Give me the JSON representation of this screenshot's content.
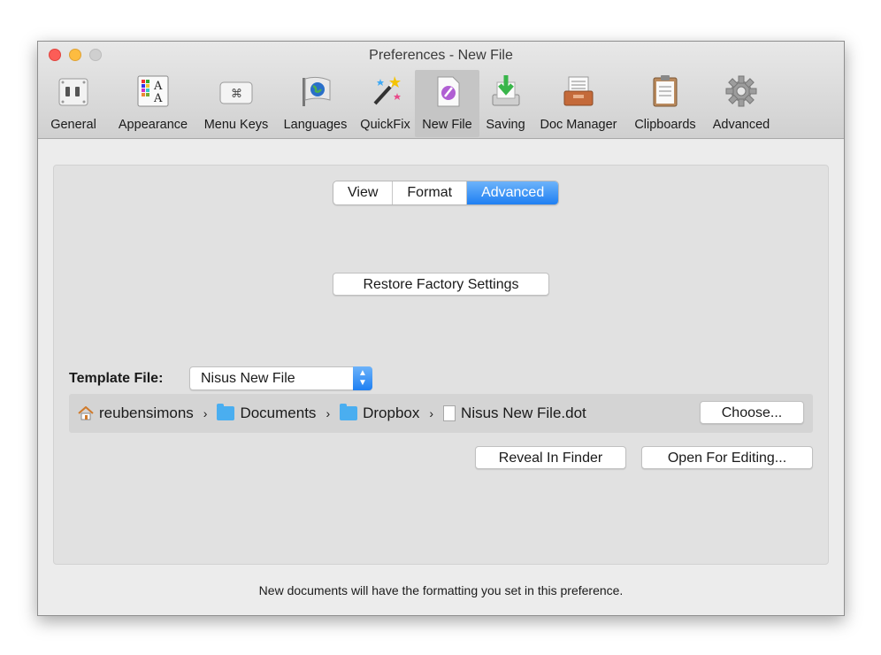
{
  "window": {
    "title": "Preferences - New File"
  },
  "toolbar": {
    "items": [
      {
        "label": "General",
        "icon": "general-switches-icon"
      },
      {
        "label": "Appearance",
        "icon": "appearance-palette-icon"
      },
      {
        "label": "Menu Keys",
        "icon": "command-key-icon"
      },
      {
        "label": "Languages",
        "icon": "globe-flag-icon"
      },
      {
        "label": "QuickFix",
        "icon": "magic-wand-icon"
      },
      {
        "label": "New File",
        "icon": "new-file-icon",
        "selected": true
      },
      {
        "label": "Saving",
        "icon": "save-tray-icon"
      },
      {
        "label": "Doc Manager",
        "icon": "doc-manager-icon"
      },
      {
        "label": "Clipboards",
        "icon": "clipboard-icon"
      },
      {
        "label": "Advanced",
        "icon": "gear-icon"
      }
    ]
  },
  "tabs": {
    "items": [
      "View",
      "Format",
      "Advanced"
    ],
    "selected": "Advanced"
  },
  "buttons": {
    "restore": "Restore Factory Settings",
    "choose": "Choose...",
    "reveal": "Reveal In Finder",
    "open_editing": "Open For Editing..."
  },
  "template": {
    "label": "Template File:",
    "value": "Nisus New File"
  },
  "path": {
    "home": "reubensimons",
    "folder1": "Documents",
    "folder2": "Dropbox",
    "file": "Nisus New File.dot"
  },
  "footer": {
    "text": "New documents will have the formatting you set in this preference."
  },
  "colors": {
    "accent": "#1e7ff2",
    "close": "#fc5d57",
    "minimize": "#fdbc40"
  }
}
